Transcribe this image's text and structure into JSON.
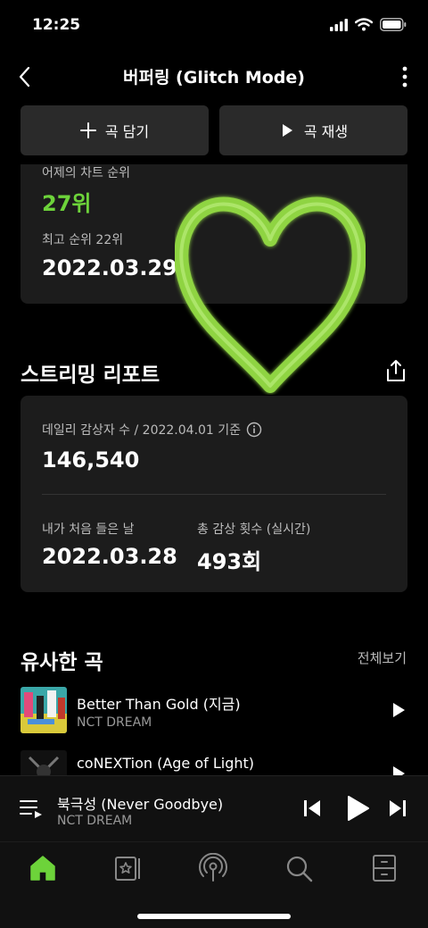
{
  "status": {
    "time": "12:25"
  },
  "nav": {
    "title": "버퍼링 (Glitch Mode)"
  },
  "actions": {
    "add_label": "곡 담기",
    "play_label": "곡 재생"
  },
  "chart": {
    "yesterday_label": "어제의 차트 순위",
    "yesterday_rank": "27위",
    "best_label": "최고 순위 22위",
    "best_date": "2022.03.29"
  },
  "streaming_report": {
    "title": "스트리밍 리포트",
    "daily_label": "데일리 감상자 수 / 2022.04.01 기준",
    "daily_value": "146,540",
    "first_listen_label": "내가 처음 들은 날",
    "first_listen_date": "2022.03.28",
    "total_label": "총 감상 횟수 (실시간)",
    "total_value": "493회"
  },
  "similar": {
    "title": "유사한 곡",
    "see_all": "전체보기",
    "songs": [
      {
        "title": "Better Than Gold (지금)",
        "artist": "NCT DREAM"
      },
      {
        "title": "coNEXTion (Age of Light)",
        "artist": ""
      }
    ]
  },
  "player": {
    "title": "북극성 (Never Goodbye)",
    "artist": "NCT DREAM"
  },
  "colors": {
    "accent": "#6dd33a",
    "heart": "#8fd443",
    "background": "#000000",
    "card": "#1c1c1c"
  },
  "tabs": [
    "home-icon",
    "library-icon",
    "podcast-icon",
    "search-icon",
    "storage-icon"
  ]
}
